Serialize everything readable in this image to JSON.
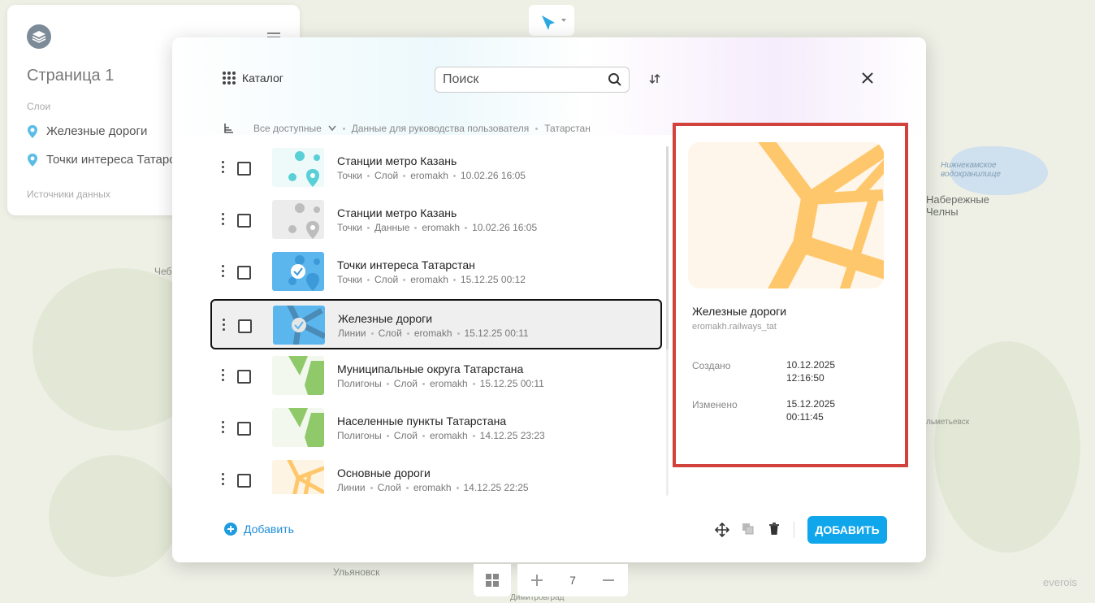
{
  "map": {
    "labels": {
      "cheb": "Чебо",
      "reservoir": "Нижнекамское водохранилище",
      "naberezhnye": "Набережные Челны",
      "almetyevsk": "льметьевск",
      "ulyanovsk": "Ульяновск",
      "dimitrovgrad": "Димитровград",
      "brand": "everois"
    }
  },
  "layers_panel": {
    "title": "Страница 1",
    "layers_label": "Слои",
    "layers": [
      {
        "name": "Железные дороги"
      },
      {
        "name": "Точки интереса Татарстан"
      }
    ],
    "sources_label": "Источники данных"
  },
  "modal": {
    "title": "Каталог",
    "search_placeholder": "Поиск",
    "breadcrumb": [
      "Все доступные",
      "Данные для руководства пользователя",
      "Татарстан"
    ],
    "items": [
      {
        "name": "Станции метро Казань",
        "type": "Точки",
        "kind": "Слой",
        "owner": "eromakh",
        "date": "10.02.26 16:05",
        "thumb": "points-teal"
      },
      {
        "name": "Станции метро Казань",
        "type": "Точки",
        "kind": "Данные",
        "owner": "eromakh",
        "date": "10.02.26 16:05",
        "thumb": "points-gray"
      },
      {
        "name": "Точки интереса Татарстан",
        "type": "Точки",
        "kind": "Слой",
        "owner": "eromakh",
        "date": "15.12.25 00:12",
        "thumb": "points-blue"
      },
      {
        "name": "Железные дороги",
        "type": "Линии",
        "kind": "Слой",
        "owner": "eromakh",
        "date": "15.12.25 00:11",
        "thumb": "lines-blue"
      },
      {
        "name": "Муниципальные округа Татарстана",
        "type": "Полигоны",
        "kind": "Слой",
        "owner": "eromakh",
        "date": "15.12.25 00:11",
        "thumb": "polygons-green"
      },
      {
        "name": "Населенные пункты Татарстана",
        "type": "Полигоны",
        "kind": "Слой",
        "owner": "eromakh",
        "date": "14.12.25 23:23",
        "thumb": "polygons-green"
      },
      {
        "name": "Основные дороги",
        "type": "Линии",
        "kind": "Слой",
        "owner": "eromakh",
        "date": "14.12.25 22:25",
        "thumb": "lines-orange"
      }
    ],
    "selected_index": 3,
    "details": {
      "name": "Железные дороги",
      "id": "eromakh.railways_tat",
      "created_label": "Создано",
      "created_date": "10.12.2025",
      "created_time": "12:16:50",
      "modified_label": "Изменено",
      "modified_date": "15.12.2025",
      "modified_time": "00:11:45"
    },
    "add_link": "Добавить",
    "add_button": "ДОБАВИТЬ"
  },
  "zoom": {
    "level": "7"
  },
  "colors": {
    "accent": "#10a6ec",
    "highlight_border": "#d0423b",
    "railway": "#ffc76b"
  }
}
